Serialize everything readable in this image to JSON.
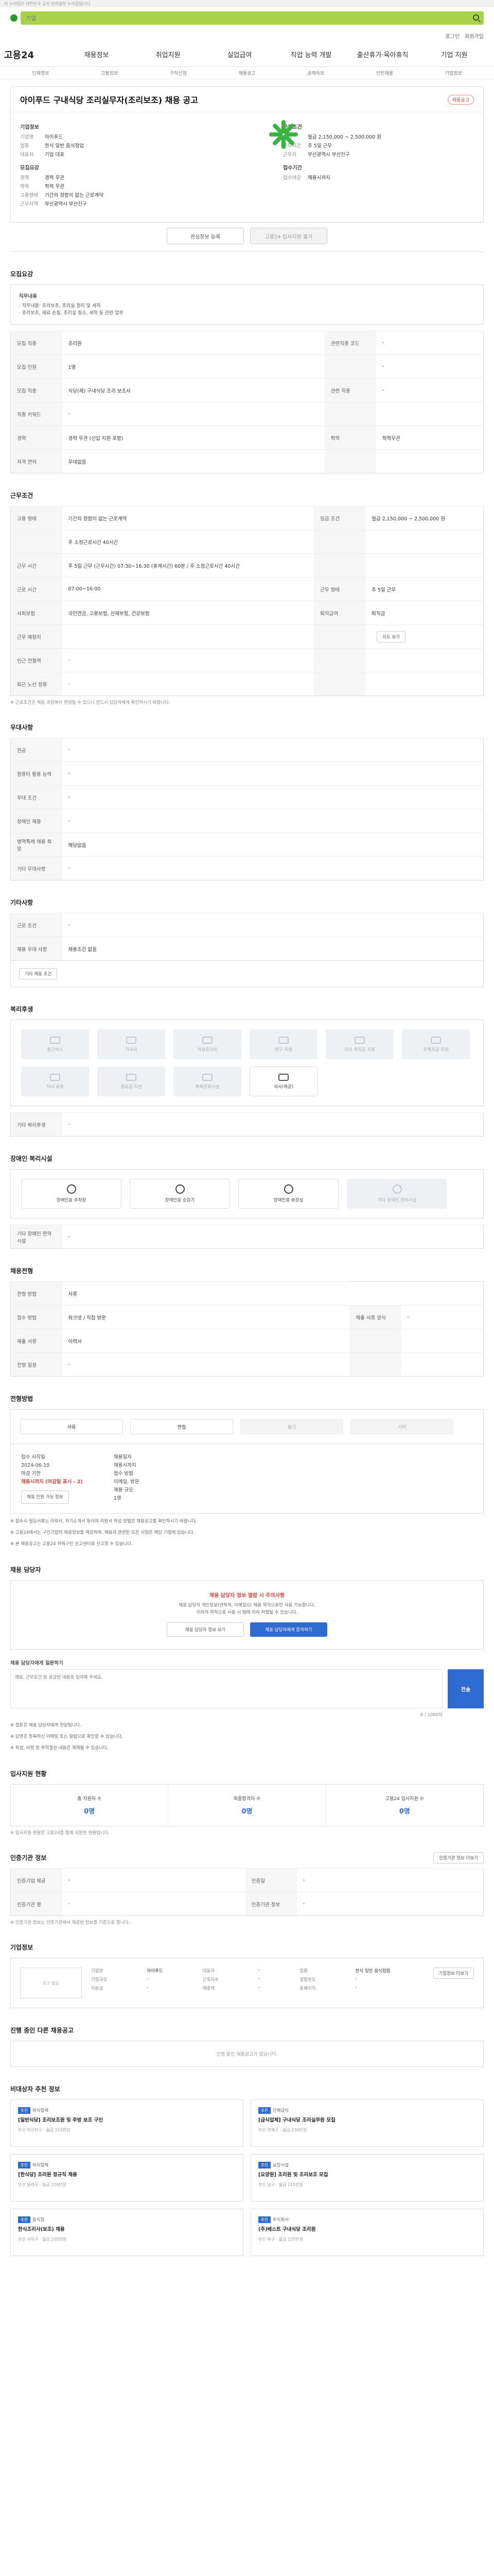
{
  "topbar": {
    "notice": "이 누리집은 대한민국 공식 전자정부 누리집입니다."
  },
  "search": {
    "placeholder": "기업"
  },
  "util": {
    "login": "로그인",
    "join": "회원가입"
  },
  "gnb": {
    "brand": "고용24",
    "menus": [
      "채용정보",
      "취업지원",
      "실업급여",
      "직업 능력 개발",
      "출산휴가·육아휴직",
      "기업 지원"
    ]
  },
  "lnb": [
    "인재정보",
    "고용정보",
    "구직신청",
    "채용공고",
    "공채속보",
    "인턴채용",
    "기업정보"
  ],
  "job": {
    "title": "아이푸드 구내식당 조리실무자(조리보조) 채용 공고",
    "badge": "채용공고",
    "company_label": "기업정보",
    "company": [
      {
        "k": "기업명",
        "v": "아이푸드"
      },
      {
        "k": "업종",
        "v": "한식 일반 음식점업"
      },
      {
        "k": "대표자",
        "v": "기업 대표"
      }
    ],
    "recruit_label": "모집요강",
    "recruit": [
      {
        "k": "경력",
        "v": "경력 무관"
      },
      {
        "k": "학력",
        "v": "학력 무관"
      },
      {
        "k": "고용형태",
        "v": "기간의 정함이 없는 근로계약"
      },
      {
        "k": "근무지역",
        "v": "부산광역시 부산진구"
      }
    ],
    "cond_label": "근무조건",
    "cond": [
      {
        "k": "임금",
        "v": "월급 2,150,000 ~ 2,500,000 원"
      },
      {
        "k": "근무시간",
        "v": "주 5일 근무"
      },
      {
        "k": "근무지",
        "v": "부산광역시 부산진구"
      }
    ],
    "period_label": "접수기간",
    "period": [
      {
        "k": "접수마감",
        "v": "채용시까지"
      }
    ],
    "scrap_button": "관심정보 등록",
    "apply_button": "고용24 입사지원 불가"
  },
  "sections": {
    "req": "모집요강",
    "work": "근무조건",
    "extra": "우대사항",
    "other": "기타사항",
    "welfare": "복리후생",
    "disability": "장애인 복리시설",
    "edu": "채용전형",
    "method": "전형방법",
    "contact": "채용 담당자",
    "status": "입사지원 현황",
    "detail": "인증기관 정보",
    "company": "기업정보",
    "ongoing": "진행 중인 다른 채용공고",
    "recommend": "비대상자 추천 정보"
  },
  "req": {
    "duty_label": "직무내용",
    "duties": [
      "· 직무내용: 조리보조, 조리실 정리 및 세척",
      "· 조리보조, 재료 손질, 조리실 청소, 세척 등 관련 업무"
    ]
  },
  "req_table": [
    [
      "모집 직종",
      "조리원",
      "관련직종 코드",
      "-"
    ],
    [
      "모집 인원",
      "1명",
      "",
      "-"
    ],
    [
      "모집 직종",
      "식당(제) 구내식당 조리 보조사",
      "관련 직종",
      "-"
    ],
    [
      "직종 키워드",
      "-",
      "",
      ""
    ],
    [
      "경력",
      "경력 무관 (신입 지원 포함)",
      "학력",
      "학력무관"
    ],
    [
      "자격 면허",
      "우대없음",
      "",
      ""
    ]
  ],
  "work_table": [
    [
      "고용 형태",
      "기간의 정함이 없는 근로계약",
      "임금 조건",
      "월급 2,150,000 ~ 2,500,000 원"
    ],
    [
      "",
      "주 소정근로시간 40시간",
      "",
      ""
    ],
    [
      "근무 시간",
      "주 5일 근무 (근무시간) 07:30~16:30 (휴게시간) 60분 / 주 소정근로시간 40시간",
      "",
      ""
    ],
    [
      "근로 시간",
      "07:00~16:00",
      "근무 형태",
      "주 5일 근무"
    ],
    [
      "사회보험",
      "국민연금, 고용보험, 산재보험, 건강보험",
      "퇴직급여",
      "퇴직금"
    ],
    [
      "근무 예정지",
      "부산광역시 부산진구 가야대로 아이푸드 구내식당",
      "",
      ""
    ],
    [
      "인근 전철역",
      "-",
      "",
      ""
    ],
    [
      "퇴근 노선 정류",
      "-",
      "",
      ""
    ]
  ],
  "work_note": "※ 근로조건은 채용 과정에서 변경될 수 있으니 반드시 담당자에게 확인하시기 바랍니다.",
  "map_button": "지도 보기",
  "extra_table": [
    [
      "전공",
      "-"
    ],
    [
      "컴퓨터 활용 능력",
      "-"
    ],
    [
      "우대 조건",
      "-"
    ],
    [
      "장애인 채용",
      "-"
    ],
    [
      "병역특례 채용 희망",
      "해당없음"
    ],
    [
      "기타 우대사항",
      "-"
    ]
  ],
  "other_table": [
    [
      "근로 조건",
      "-"
    ],
    [
      "채용 우대 사항",
      "채용조건 없음"
    ]
  ],
  "other_check": "기타 채용 조건",
  "welfare_items": [
    {
      "label": "통근버스",
      "on": false
    },
    {
      "label": "기숙사",
      "on": false
    },
    {
      "label": "차량유지비",
      "on": false
    },
    {
      "label": "연구 지원",
      "on": false
    },
    {
      "label": "자녀 학자금 지원",
      "on": false
    },
    {
      "label": "주택자금 지원",
      "on": false
    },
    {
      "label": "자녀 보육",
      "on": false
    },
    {
      "label": "경조금 지원",
      "on": false
    },
    {
      "label": "체육문화시설",
      "on": false
    },
    {
      "label": "식사(제공)",
      "on": true
    }
  ],
  "welfare_table": [
    [
      "기타 복리후생",
      "-"
    ]
  ],
  "disability_items": [
    {
      "label": "장애인용 주차장",
      "on": true
    },
    {
      "label": "장애인용 승강기",
      "on": true
    },
    {
      "label": "장애인용 화장실",
      "on": true
    },
    {
      "label": "기타 장애인 편의시설",
      "on": false
    }
  ],
  "disability_table": [
    [
      "기타 장애인 편의시설",
      "-"
    ]
  ],
  "edu_table": [
    [
      "전형 방법",
      "서류"
    ],
    [
      "접수 방법",
      "워크넷 / 직접 방문",
      "제출 서류 양식",
      "-"
    ],
    [
      "제출 서류",
      "이력서",
      "",
      ""
    ],
    [
      "전형 일정",
      "-",
      "",
      ""
    ]
  ],
  "method_items": [
    {
      "label": "서류",
      "on": true
    },
    {
      "label": "면접",
      "on": true
    },
    {
      "label": "필기",
      "on": false
    },
    {
      "label": "기타",
      "on": false
    }
  ],
  "deadline": {
    "reg_label": "접수 시작일",
    "reg_value": "2024-06-10",
    "end_label": "마감 기한",
    "end_value": "채용시까지 (마감일 표시 - 2)",
    "dday_label": "채용일자",
    "dday_value": "채용시까지",
    "method_label": "접수 방법",
    "method_value": "이메일, 방문",
    "fax_label": "채용 규모",
    "fax_value": "1명",
    "button": "채용 인원 가능 정보"
  },
  "notices": [
    "※ 접수시 필요서류는 이력서, 자기소개서 등이며 지원서 작성 방법은 채용공고를 확인하시기 바랍니다.",
    "※ 고용24에서는 구인기업의 채용정보를 제공하며, 채용과 관련된 모든 사항은 해당 기업에 있습니다.",
    "※ 본 채용공고는 고용24 허위구인 신고센터로 신고할 수 있습니다."
  ],
  "contact": {
    "alert": "채용 담당자 정보 열람 시 주의사항",
    "desc1": "채용 담당자 개인정보(연락처, 이메일)는 채용 목적으로만 사용 가능합니다.",
    "desc2": "이외의 목적으로 사용 시 법에 따라 처벌될 수 있습니다.",
    "btn1": "채용 담당자 정보 보기",
    "btn2": "채용 담당자에게 문의하기",
    "inq_label": "채용 담당자에게 질문하기",
    "placeholder": "채용, 근무조건 등 궁금한 내용을 입력해 주세요.",
    "count": "0 / 1000자",
    "send": "전송",
    "notes": [
      "※ 질문은 채용 담당자에게 전달됩니다.",
      "※ 답변은 등록하신 이메일 또는 알림으로 확인할 수 있습니다.",
      "※ 욕설, 비방 등 부적절한 내용은 제재될 수 있습니다."
    ]
  },
  "status": [
    {
      "t": "총 지원자 수",
      "n": "0명"
    },
    {
      "t": "최종합격자 수",
      "n": "0명"
    },
    {
      "t": "고용24 입사지원 수",
      "n": "0명"
    }
  ],
  "status_note": "※ 입사지원 현황은 고용24를 통해 지원한 현황입니다.",
  "detail_table": [
    [
      "인증기업 제공",
      "-",
      "인증일",
      "-"
    ],
    [
      "인증기관 명",
      "-",
      "인증기관 정보",
      "-"
    ]
  ],
  "detail_note": "※ 인증기관 정보는 인증기관에서 제공한 정보를 기준으로 합니다.",
  "detail_button": "인증기관 정보 더보기",
  "company_info": {
    "logo": "로고 없음",
    "rows": [
      [
        "기업명",
        "아이푸드",
        "대표자",
        "-",
        "업종",
        "한식 일반 음식점업"
      ],
      [
        "기업규모",
        "-",
        "근로자수",
        "-",
        "설립연도",
        "-"
      ],
      [
        "자본금",
        "-",
        "매출액",
        "-",
        "홈페이지",
        "-"
      ]
    ],
    "button": "기업정보 더보기"
  },
  "ongoing_empty": "진행 중인 채용공고가 없습니다.",
  "recommend": [
    {
      "tag": "추천",
      "org": "외식업체",
      "title": "[일반식당] 조리보조원 및 주방 보조 구인",
      "meta": "부산 부산진구 · 월급 210만원"
    },
    {
      "tag": "추천",
      "org": "단체급식",
      "title": "[급식업체] 구내식당 조리실무원 모집",
      "meta": "부산 연제구 · 월급 230만원"
    },
    {
      "tag": "추천",
      "org": "외식업체",
      "title": "[한식당] 조리원 정규직 채용",
      "meta": "부산 동래구 · 월급 220만원"
    },
    {
      "tag": "추천",
      "org": "요양시설",
      "title": "[요양원] 조리원 및 조리보조 모집",
      "meta": "부산 남구 · 월급 215만원"
    },
    {
      "tag": "추천",
      "org": "음식점",
      "title": "한식조리사(보조) 채용",
      "meta": "부산 사하구 · 월급 205만원"
    },
    {
      "tag": "추천",
      "org": "주식회사",
      "title": "(주)베스트 구내식당 조리원",
      "meta": "부산 북구 · 월급 225만원"
    }
  ]
}
